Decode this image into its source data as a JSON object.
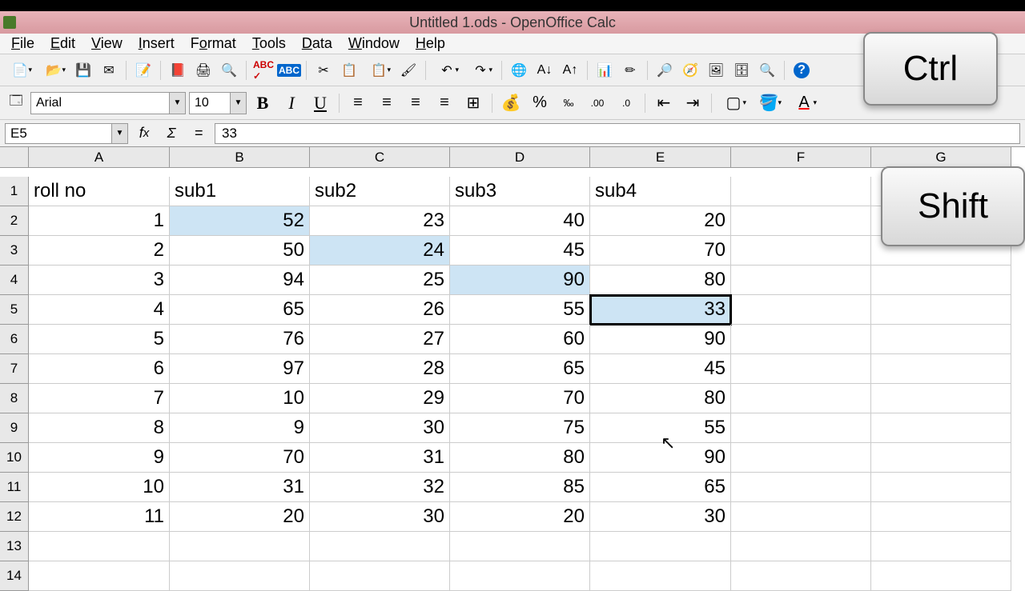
{
  "title": "Untitled 1.ods - OpenOffice Calc",
  "menus": [
    "File",
    "Edit",
    "View",
    "Insert",
    "Format",
    "Tools",
    "Data",
    "Window",
    "Help"
  ],
  "font_name": "Arial",
  "font_size": "10",
  "name_box": "E5",
  "formula": "33",
  "keys": {
    "ctrl": "Ctrl",
    "shift": "Shift"
  },
  "columns": [
    "A",
    "B",
    "C",
    "D",
    "E",
    "F",
    "G"
  ],
  "row_count": 14,
  "selection": {
    "range": [
      [
        "B",
        2
      ],
      [
        "C",
        3
      ],
      [
        "D",
        4
      ],
      [
        "E",
        5
      ]
    ],
    "active": "E5"
  },
  "grid": {
    "A1": {
      "t": "text",
      "v": "roll no"
    },
    "B1": {
      "t": "text",
      "v": "sub1"
    },
    "C1": {
      "t": "text",
      "v": "sub2"
    },
    "D1": {
      "t": "text",
      "v": "sub3"
    },
    "E1": {
      "t": "text",
      "v": "sub4"
    },
    "A2": {
      "t": "num",
      "v": "1"
    },
    "B2": {
      "t": "num",
      "v": "52"
    },
    "C2": {
      "t": "num",
      "v": "23"
    },
    "D2": {
      "t": "num",
      "v": "40"
    },
    "E2": {
      "t": "num",
      "v": "20"
    },
    "A3": {
      "t": "num",
      "v": "2"
    },
    "B3": {
      "t": "num",
      "v": "50"
    },
    "C3": {
      "t": "num",
      "v": "24"
    },
    "D3": {
      "t": "num",
      "v": "45"
    },
    "E3": {
      "t": "num",
      "v": "70"
    },
    "A4": {
      "t": "num",
      "v": "3"
    },
    "B4": {
      "t": "num",
      "v": "94"
    },
    "C4": {
      "t": "num",
      "v": "25"
    },
    "D4": {
      "t": "num",
      "v": "90"
    },
    "E4": {
      "t": "num",
      "v": "80"
    },
    "A5": {
      "t": "num",
      "v": "4"
    },
    "B5": {
      "t": "num",
      "v": "65"
    },
    "C5": {
      "t": "num",
      "v": "26"
    },
    "D5": {
      "t": "num",
      "v": "55"
    },
    "E5": {
      "t": "num",
      "v": "33"
    },
    "A6": {
      "t": "num",
      "v": "5"
    },
    "B6": {
      "t": "num",
      "v": "76"
    },
    "C6": {
      "t": "num",
      "v": "27"
    },
    "D6": {
      "t": "num",
      "v": "60"
    },
    "E6": {
      "t": "num",
      "v": "90"
    },
    "A7": {
      "t": "num",
      "v": "6"
    },
    "B7": {
      "t": "num",
      "v": "97"
    },
    "C7": {
      "t": "num",
      "v": "28"
    },
    "D7": {
      "t": "num",
      "v": "65"
    },
    "E7": {
      "t": "num",
      "v": "45"
    },
    "A8": {
      "t": "num",
      "v": "7"
    },
    "B8": {
      "t": "num",
      "v": "10"
    },
    "C8": {
      "t": "num",
      "v": "29"
    },
    "D8": {
      "t": "num",
      "v": "70"
    },
    "E8": {
      "t": "num",
      "v": "80"
    },
    "A9": {
      "t": "num",
      "v": "8"
    },
    "B9": {
      "t": "num",
      "v": "9"
    },
    "C9": {
      "t": "num",
      "v": "30"
    },
    "D9": {
      "t": "num",
      "v": "75"
    },
    "E9": {
      "t": "num",
      "v": "55"
    },
    "A10": {
      "t": "num",
      "v": "9"
    },
    "B10": {
      "t": "num",
      "v": "70"
    },
    "C10": {
      "t": "num",
      "v": "31"
    },
    "D10": {
      "t": "num",
      "v": "80"
    },
    "E10": {
      "t": "num",
      "v": "90"
    },
    "A11": {
      "t": "num",
      "v": "10"
    },
    "B11": {
      "t": "num",
      "v": "31"
    },
    "C11": {
      "t": "num",
      "v": "32"
    },
    "D11": {
      "t": "num",
      "v": "85"
    },
    "E11": {
      "t": "num",
      "v": "65"
    },
    "A12": {
      "t": "num",
      "v": "11"
    },
    "B12": {
      "t": "num",
      "v": "20"
    },
    "C12": {
      "t": "num",
      "v": "30"
    },
    "D12": {
      "t": "num",
      "v": "20"
    },
    "E12": {
      "t": "num",
      "v": "30"
    }
  }
}
